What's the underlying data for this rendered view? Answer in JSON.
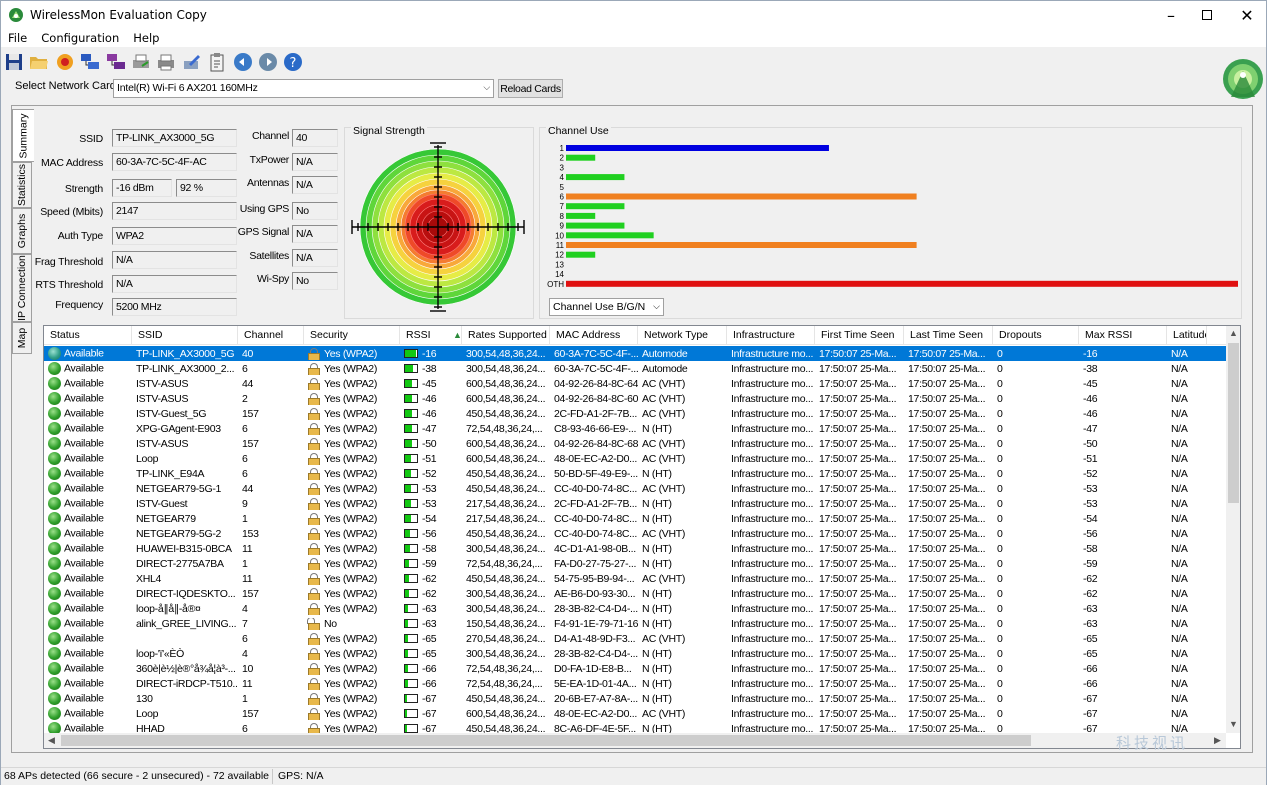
{
  "window": {
    "title": "WirelessMon Evaluation Copy"
  },
  "menu": [
    "File",
    "Configuration",
    "Help"
  ],
  "toolbar_icons": [
    "save-icon",
    "open-folder-icon",
    "record-icon",
    "network-cards-icon",
    "network-cards-purple-icon",
    "printer-export-icon",
    "printer-icon",
    "pen-icon",
    "clipboard-icon",
    "globe-back-icon",
    "globe-forward-icon",
    "help-icon"
  ],
  "card": {
    "label": "Select Network Card",
    "selected": "Intel(R) Wi-Fi 6 AX201 160MHz",
    "reload": "Reload Cards"
  },
  "tabs": [
    "Summary",
    "Statistics",
    "Graphs",
    "IP Connection",
    "Map"
  ],
  "summary": {
    "fields": [
      {
        "label": "SSID",
        "value": "TP-LINK_AX3000_5G"
      },
      {
        "label": "MAC Address",
        "value": "60-3A-7C-5C-4F-AC"
      },
      {
        "label": "Strength",
        "value": "-16 dBm",
        "value2": "92 %"
      },
      {
        "label": "Speed (Mbits)",
        "value": "2147"
      },
      {
        "label": "Auth Type",
        "value": "WPA2"
      },
      {
        "label": "Frag Threshold",
        "value": "N/A"
      },
      {
        "label": "RTS Threshold",
        "value": "N/A"
      },
      {
        "label": "Frequency",
        "value": "5200 MHz"
      }
    ],
    "fields2": [
      {
        "label": "Channel",
        "value": "40"
      },
      {
        "label": "TxPower",
        "value": "N/A"
      },
      {
        "label": "Antennas",
        "value": "N/A"
      },
      {
        "label": "Using GPS",
        "value": "No"
      },
      {
        "label": "GPS Signal",
        "value": "N/A"
      },
      {
        "label": "Satellites",
        "value": "N/A"
      },
      {
        "label": "Wi-Spy",
        "value": "No"
      }
    ],
    "signal_title": "Signal Strength",
    "channel_title": "Channel Use",
    "channel_select": "Channel Use B/G/N"
  },
  "chart_data": {
    "type": "bar",
    "title": "Channel Use",
    "categories": [
      "1",
      "2",
      "3",
      "4",
      "5",
      "6",
      "7",
      "8",
      "9",
      "10",
      "11",
      "12",
      "13",
      "14",
      "OTH"
    ],
    "values": [
      9,
      1,
      0,
      2,
      0,
      12,
      2,
      1,
      2,
      3,
      12,
      1,
      0,
      0,
      23
    ],
    "colors": [
      "#0000e0",
      "#20d020",
      "#20d020",
      "#20d020",
      "#20d020",
      "#f08020",
      "#20d020",
      "#20d020",
      "#20d020",
      "#20d020",
      "#f08020",
      "#20d020",
      "#20d020",
      "#20d020",
      "#e01010"
    ],
    "xlim": [
      0,
      23
    ]
  },
  "table": {
    "columns": [
      "Status",
      "SSID",
      "Channel",
      "Security",
      "RSSI",
      "Rates Supported",
      "MAC Address",
      "Network Type",
      "Infrastructure",
      "First Time Seen",
      "Last Time Seen",
      "Dropouts",
      "Max RSSI",
      "Latitude"
    ],
    "rows": [
      [
        "Available",
        "TP-LINK_AX3000_5G",
        "40",
        "Yes (WPA2)",
        "-16",
        "300,54,48,36,24...",
        "60-3A-7C-5C-4F-...",
        "Automode",
        "Infrastructure mo...",
        "17:50:07 25-Ma...",
        "17:50:07 25-Ma...",
        "0",
        "-16",
        "N/A"
      ],
      [
        "Available",
        "TP-LINK_AX3000_2...",
        "6",
        "Yes (WPA2)",
        "-38",
        "300,54,48,36,24...",
        "60-3A-7C-5C-4F-...",
        "Automode",
        "Infrastructure mo...",
        "17:50:07 25-Ma...",
        "17:50:07 25-Ma...",
        "0",
        "-38",
        "N/A"
      ],
      [
        "Available",
        "ISTV-ASUS",
        "44",
        "Yes (WPA2)",
        "-45",
        "600,54,48,36,24...",
        "04-92-26-84-8C-64",
        "AC (VHT)",
        "Infrastructure mo...",
        "17:50:07 25-Ma...",
        "17:50:07 25-Ma...",
        "0",
        "-45",
        "N/A"
      ],
      [
        "Available",
        "ISTV-ASUS",
        "2",
        "Yes (WPA2)",
        "-46",
        "600,54,48,36,24...",
        "04-92-26-84-8C-60",
        "AC (VHT)",
        "Infrastructure mo...",
        "17:50:07 25-Ma...",
        "17:50:07 25-Ma...",
        "0",
        "-46",
        "N/A"
      ],
      [
        "Available",
        "ISTV-Guest_5G",
        "157",
        "Yes (WPA2)",
        "-46",
        "450,54,48,36,24...",
        "2C-FD-A1-2F-7B...",
        "AC (VHT)",
        "Infrastructure mo...",
        "17:50:07 25-Ma...",
        "17:50:07 25-Ma...",
        "0",
        "-46",
        "N/A"
      ],
      [
        "Available",
        "XPG-GAgent-E903",
        "6",
        "Yes (WPA2)",
        "-47",
        "72,54,48,36,24,...",
        "C8-93-46-66-E9-...",
        "N (HT)",
        "Infrastructure mo...",
        "17:50:07 25-Ma...",
        "17:50:07 25-Ma...",
        "0",
        "-47",
        "N/A"
      ],
      [
        "Available",
        "ISTV-ASUS",
        "157",
        "Yes (WPA2)",
        "-50",
        "600,54,48,36,24...",
        "04-92-26-84-8C-68",
        "AC (VHT)",
        "Infrastructure mo...",
        "17:50:07 25-Ma...",
        "17:50:07 25-Ma...",
        "0",
        "-50",
        "N/A"
      ],
      [
        "Available",
        "Loop",
        "6",
        "Yes (WPA2)",
        "-51",
        "600,54,48,36,24...",
        "48-0E-EC-A2-D0...",
        "AC (VHT)",
        "Infrastructure mo...",
        "17:50:07 25-Ma...",
        "17:50:07 25-Ma...",
        "0",
        "-51",
        "N/A"
      ],
      [
        "Available",
        "TP-LINK_E94A",
        "6",
        "Yes (WPA2)",
        "-52",
        "450,54,48,36,24...",
        "50-BD-5F-49-E9-...",
        "N (HT)",
        "Infrastructure mo...",
        "17:50:07 25-Ma...",
        "17:50:07 25-Ma...",
        "0",
        "-52",
        "N/A"
      ],
      [
        "Available",
        "NETGEAR79-5G-1",
        "44",
        "Yes (WPA2)",
        "-53",
        "450,54,48,36,24...",
        "CC-40-D0-74-8C...",
        "AC (VHT)",
        "Infrastructure mo...",
        "17:50:07 25-Ma...",
        "17:50:07 25-Ma...",
        "0",
        "-53",
        "N/A"
      ],
      [
        "Available",
        "ISTV-Guest",
        "9",
        "Yes (WPA2)",
        "-53",
        "217,54,48,36,24...",
        "2C-FD-A1-2F-7B...",
        "N (HT)",
        "Infrastructure mo...",
        "17:50:07 25-Ma...",
        "17:50:07 25-Ma...",
        "0",
        "-53",
        "N/A"
      ],
      [
        "Available",
        "NETGEAR79",
        "1",
        "Yes (WPA2)",
        "-54",
        "217,54,48,36,24...",
        "CC-40-D0-74-8C...",
        "N (HT)",
        "Infrastructure mo...",
        "17:50:07 25-Ma...",
        "17:50:07 25-Ma...",
        "0",
        "-54",
        "N/A"
      ],
      [
        "Available",
        "NETGEAR79-5G-2",
        "153",
        "Yes (WPA2)",
        "-56",
        "450,54,48,36,24...",
        "CC-40-D0-74-8C...",
        "AC (VHT)",
        "Infrastructure mo...",
        "17:50:07 25-Ma...",
        "17:50:07 25-Ma...",
        "0",
        "-56",
        "N/A"
      ],
      [
        "Available",
        "HUAWEI-B315-0BCA",
        "11",
        "Yes (WPA2)",
        "-58",
        "300,54,48,36,24...",
        "4C-D1-A1-98-0B...",
        "N (HT)",
        "Infrastructure mo...",
        "17:50:07 25-Ma...",
        "17:50:07 25-Ma...",
        "0",
        "-58",
        "N/A"
      ],
      [
        "Available",
        "DIRECT-2775A7BA",
        "1",
        "Yes (WPA2)",
        "-59",
        "72,54,48,36,24,...",
        "FA-D0-27-75-27-...",
        "N (HT)",
        "Infrastructure mo...",
        "17:50:07 25-Ma...",
        "17:50:07 25-Ma...",
        "0",
        "-59",
        "N/A"
      ],
      [
        "Available",
        "XHL4",
        "11",
        "Yes (WPA2)",
        "-62",
        "450,54,48,36,24...",
        "54-75-95-B9-94-...",
        "AC (VHT)",
        "Infrastructure mo...",
        "17:50:07 25-Ma...",
        "17:50:07 25-Ma...",
        "0",
        "-62",
        "N/A"
      ],
      [
        "Available",
        "DIRECT-IQDESKTO...",
        "157",
        "Yes (WPA2)",
        "-62",
        "300,54,48,36,24...",
        "AE-B6-D0-93-30...",
        "N (HT)",
        "Infrastructure mo...",
        "17:50:07 25-Ma...",
        "17:50:07 25-Ma...",
        "0",
        "-62",
        "N/A"
      ],
      [
        "Available",
        "loop-å∥å∥-å®¤",
        "4",
        "Yes (WPA2)",
        "-63",
        "300,54,48,36,24...",
        "28-3B-82-C4-D4-...",
        "N (HT)",
        "Infrastructure mo...",
        "17:50:07 25-Ma...",
        "17:50:07 25-Ma...",
        "0",
        "-63",
        "N/A"
      ],
      [
        "Available",
        "alink_GREE_LIVING...",
        "7",
        "No",
        "-63",
        "150,54,48,36,24...",
        "F4-91-1E-79-71-16",
        "N (HT)",
        "Infrastructure mo...",
        "17:50:07 25-Ma...",
        "17:50:07 25-Ma...",
        "0",
        "-63",
        "N/A"
      ],
      [
        "Available",
        "",
        "6",
        "Yes (WPA2)",
        "-65",
        "270,54,48,36,24...",
        "D4-A1-48-9D-F3...",
        "AC (VHT)",
        "Infrastructure mo...",
        "17:50:07 25-Ma...",
        "17:50:07 25-Ma...",
        "0",
        "-65",
        "N/A"
      ],
      [
        "Available",
        "loop-'ï'«ÈÒ",
        "4",
        "Yes (WPA2)",
        "-65",
        "300,54,48,36,24...",
        "28-3B-82-C4-D4-...",
        "N (HT)",
        "Infrastructure mo...",
        "17:50:07 25-Ma...",
        "17:50:07 25-Ma...",
        "0",
        "-65",
        "N/A"
      ],
      [
        "Available",
        "360è|è½|è®°å¾å¦à³-...",
        "10",
        "Yes (WPA2)",
        "-66",
        "72,54,48,36,24,...",
        "D0-FA-1D-E8-B...",
        "N (HT)",
        "Infrastructure mo...",
        "17:50:07 25-Ma...",
        "17:50:07 25-Ma...",
        "0",
        "-66",
        "N/A"
      ],
      [
        "Available",
        "DIRECT-iRDCP-T510...",
        "11",
        "Yes (WPA2)",
        "-66",
        "72,54,48,36,24,...",
        "5E-EA-1D-01-4A...",
        "N (HT)",
        "Infrastructure mo...",
        "17:50:07 25-Ma...",
        "17:50:07 25-Ma...",
        "0",
        "-66",
        "N/A"
      ],
      [
        "Available",
        "130",
        "1",
        "Yes (WPA2)",
        "-67",
        "450,54,48,36,24...",
        "20-6B-E7-A7-8A-...",
        "N (HT)",
        "Infrastructure mo...",
        "17:50:07 25-Ma...",
        "17:50:07 25-Ma...",
        "0",
        "-67",
        "N/A"
      ],
      [
        "Available",
        "Loop",
        "157",
        "Yes (WPA2)",
        "-67",
        "600,54,48,36,24...",
        "48-0E-EC-A2-D0...",
        "AC (VHT)",
        "Infrastructure mo...",
        "17:50:07 25-Ma...",
        "17:50:07 25-Ma...",
        "0",
        "-67",
        "N/A"
      ],
      [
        "Available",
        "HHAD",
        "6",
        "Yes (WPA2)",
        "-67",
        "450,54,48,36,24...",
        "8C-A6-DF-4E-5F...",
        "N (HT)",
        "Infrastructure mo...",
        "17:50:07 25-Ma...",
        "17:50:07 25-Ma...",
        "0",
        "-67",
        "N/A"
      ]
    ],
    "signal_levels": [
      0.95,
      0.7,
      0.62,
      0.6,
      0.6,
      0.58,
      0.55,
      0.52,
      0.5,
      0.48,
      0.48,
      0.46,
      0.42,
      0.38,
      0.36,
      0.3,
      0.3,
      0.28,
      0.28,
      0.24,
      0.24,
      0.22,
      0.22,
      0.2,
      0.2,
      0.2
    ]
  },
  "statusbar": {
    "aps": "68 APs detected (66 secure - 2 unsecured) - 72 available",
    "gps": "GPS: N/A"
  },
  "watermark": "科技视讯"
}
